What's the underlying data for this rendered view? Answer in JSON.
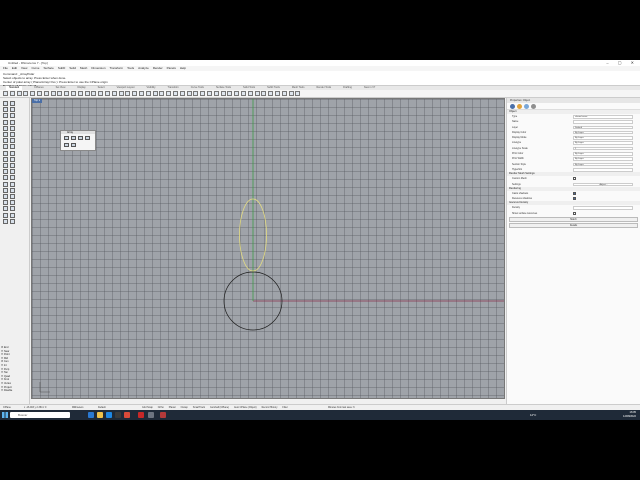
{
  "window": {
    "title": "Untitled - Rhinoceros 7 - [Top]",
    "controls": "– ▢ ✕"
  },
  "menu": [
    "File",
    "Edit",
    "View",
    "Curve",
    "Surface",
    "SubD",
    "Solid",
    "Mesh",
    "Dimension",
    "Transform",
    "Tools",
    "Analyze",
    "Render",
    "Panels",
    "Help"
  ],
  "command_history": {
    "line1": "Command: _ArrayPolar",
    "line2": "Select objects to array. Press Enter when done.",
    "line3": "Center of polar array ( PlanarArray=Yes ): Press Enter to use the CPlane origin",
    "line4": "Number of items <4>: 5",
    "prompt": "Command:"
  },
  "toolbar_tabs": [
    "Standard",
    "CPlanes",
    "Set View",
    "Display",
    "Select",
    "Viewport Layout",
    "Visibility",
    "Transform",
    "Curve Tools",
    "Surface Tools",
    "Solid Tools",
    "SubD Tools",
    "Mesh Tools",
    "Render Tools",
    "Drafting",
    "New in V7"
  ],
  "viewport": {
    "tab_label": "Top ▾"
  },
  "array_panel": {
    "title": "Array"
  },
  "osnap": {
    "items": [
      {
        "label": "End",
        "checked": true
      },
      {
        "label": "Near",
        "checked": false
      },
      {
        "label": "Point",
        "checked": false
      },
      {
        "label": "Mid",
        "checked": false
      },
      {
        "label": "Cen",
        "checked": true
      },
      {
        "label": "Int",
        "checked": false
      },
      {
        "label": "Perp",
        "checked": false
      },
      {
        "label": "Tan",
        "checked": false
      },
      {
        "label": "Quad",
        "checked": false
      },
      {
        "label": "Knot",
        "checked": false
      },
      {
        "label": "Vertex",
        "checked": false
      },
      {
        "label": "Project",
        "checked": false
      },
      {
        "label": "Disable",
        "checked": false
      }
    ]
  },
  "properties": {
    "header": "Properties: Object",
    "section_object": "Object",
    "rows": [
      {
        "label": "Type",
        "value": "closed curve"
      },
      {
        "label": "Name",
        "value": ""
      },
      {
        "label": "Layer",
        "value": "Default"
      },
      {
        "label": "Display Color",
        "value": "By Layer"
      },
      {
        "label": "Display Mode",
        "value": "By Layer"
      },
      {
        "label": "Linetype",
        "value": "By Layer"
      },
      {
        "label": "Linetype Scale",
        "value": "1"
      },
      {
        "label": "Print Color",
        "value": "By Layer"
      },
      {
        "label": "Print Width",
        "value": "By Layer"
      },
      {
        "label": "Section Style",
        "value": "By Layer"
      },
      {
        "label": "Hyperlink",
        "value": ""
      }
    ],
    "section_render_mesh": "Render Mesh Settings",
    "custom_mesh_label": "Custom Mesh",
    "settings_label": "Settings",
    "adjust_button": "Adjust...",
    "section_rendering": "Rendering",
    "casts_shadows": "Casts shadows",
    "receives_shadows": "Receives shadows",
    "section_isocurve": "Isocurve Density",
    "density_label": "Density",
    "show_surface_isocurves": "Show surface isocurves",
    "match_button": "Match",
    "details_button": "Details"
  },
  "statusbar": {
    "cplane": "CPlane",
    "coords": "x -16.003  y 2.364  z 0",
    "units": "Millimeters",
    "layer": "Default",
    "toggles": [
      "Grid Snap",
      "Ortho",
      "Planar",
      "Osnap",
      "SmartTrack",
      "Gumball (CPlane)",
      "Auto CPlane (Object)",
      "Record History",
      "Filter"
    ],
    "message": "Minutes from last save: 6"
  },
  "taskbar": {
    "search_placeholder": "Buscar",
    "weather": "12°C",
    "time": "16:05",
    "date": "12/08/2022"
  },
  "colors": {
    "viewport_bg": "#9fa3a9",
    "x_axis": "#8a2f4d",
    "y_axis": "#3f9a47",
    "selected_curve": "#e4dc82",
    "circle": "#1c1c1c",
    "taskbar": "#1f2a38"
  }
}
